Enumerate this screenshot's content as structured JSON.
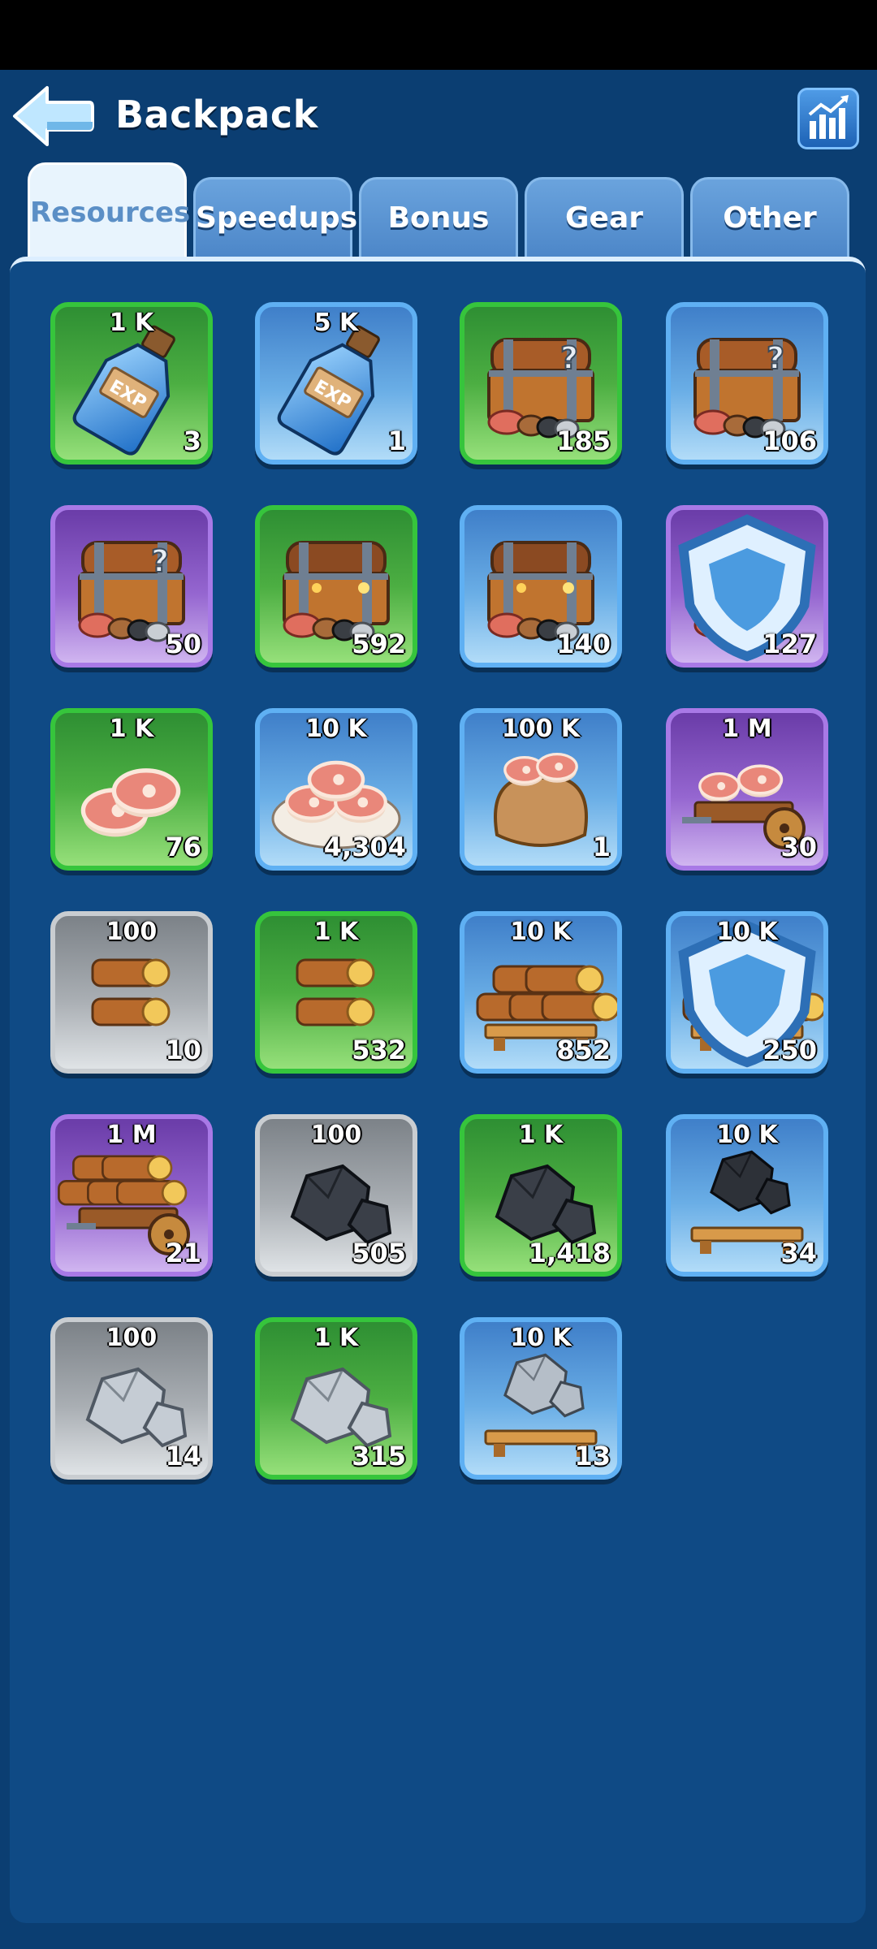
{
  "header": {
    "title": "Backpack",
    "back_icon": "back-arrow-icon",
    "stats_icon": "bar-chart-icon"
  },
  "tabs": [
    {
      "label": "Resources",
      "active": true
    },
    {
      "label": "Speedups",
      "active": false
    },
    {
      "label": "Bonus",
      "active": false
    },
    {
      "label": "Gear",
      "active": false
    },
    {
      "label": "Other",
      "active": false
    }
  ],
  "colors": {
    "green": "#36c53c",
    "blue": "#5fb0f3",
    "purple": "#a879e6",
    "gray": "#c9cdd1",
    "background": "#0b3e72"
  },
  "items": [
    {
      "name": "exp-potion",
      "badge": "1 K",
      "count": "3",
      "rarity": "green",
      "icon": "exp-bottle-icon"
    },
    {
      "name": "exp-potion",
      "badge": "5 K",
      "count": "1",
      "rarity": "blue",
      "icon": "exp-bottle-icon"
    },
    {
      "name": "resource-chest",
      "badge": "",
      "count": "185",
      "rarity": "green",
      "icon": "mystery-chest-icon"
    },
    {
      "name": "resource-chest",
      "badge": "",
      "count": "106",
      "rarity": "blue",
      "icon": "mystery-chest-icon"
    },
    {
      "name": "resource-chest",
      "badge": "",
      "count": "50",
      "rarity": "purple",
      "icon": "mystery-chest-icon"
    },
    {
      "name": "resource-chest",
      "badge": "",
      "count": "592",
      "rarity": "green",
      "icon": "select-chest-icon"
    },
    {
      "name": "resource-chest",
      "badge": "",
      "count": "140",
      "rarity": "blue",
      "icon": "select-chest-icon"
    },
    {
      "name": "resource-chest",
      "badge": "",
      "count": "127",
      "rarity": "purple",
      "icon": "select-chest-icon",
      "shield": true
    },
    {
      "name": "meat",
      "badge": "1 K",
      "count": "76",
      "rarity": "green",
      "icon": "meat-icon"
    },
    {
      "name": "meat",
      "badge": "10 K",
      "count": "4,304",
      "rarity": "blue",
      "icon": "meat-plate-icon"
    },
    {
      "name": "meat",
      "badge": "100 K",
      "count": "1",
      "rarity": "blue",
      "icon": "meat-sack-icon"
    },
    {
      "name": "meat",
      "badge": "1 M",
      "count": "30",
      "rarity": "purple",
      "icon": "meat-cart-icon"
    },
    {
      "name": "wood",
      "badge": "100",
      "count": "10",
      "rarity": "gray",
      "icon": "wood-icon"
    },
    {
      "name": "wood",
      "badge": "1 K",
      "count": "532",
      "rarity": "green",
      "icon": "wood-icon"
    },
    {
      "name": "wood",
      "badge": "10 K",
      "count": "852",
      "rarity": "blue",
      "icon": "wood-pallet-icon"
    },
    {
      "name": "wood",
      "badge": "10 K",
      "count": "250",
      "rarity": "blue",
      "icon": "wood-pallet-icon",
      "shield": true
    },
    {
      "name": "wood",
      "badge": "1 M",
      "count": "21",
      "rarity": "purple",
      "icon": "wood-cart-icon"
    },
    {
      "name": "coal",
      "badge": "100",
      "count": "505",
      "rarity": "gray",
      "icon": "coal-icon"
    },
    {
      "name": "coal",
      "badge": "1 K",
      "count": "1,418",
      "rarity": "green",
      "icon": "coal-icon"
    },
    {
      "name": "coal",
      "badge": "10 K",
      "count": "34",
      "rarity": "blue",
      "icon": "coal-pallet-icon"
    },
    {
      "name": "iron",
      "badge": "100",
      "count": "14",
      "rarity": "gray",
      "icon": "iron-icon"
    },
    {
      "name": "iron",
      "badge": "1 K",
      "count": "315",
      "rarity": "green",
      "icon": "iron-icon"
    },
    {
      "name": "iron",
      "badge": "10 K",
      "count": "13",
      "rarity": "blue",
      "icon": "iron-pallet-icon"
    }
  ]
}
